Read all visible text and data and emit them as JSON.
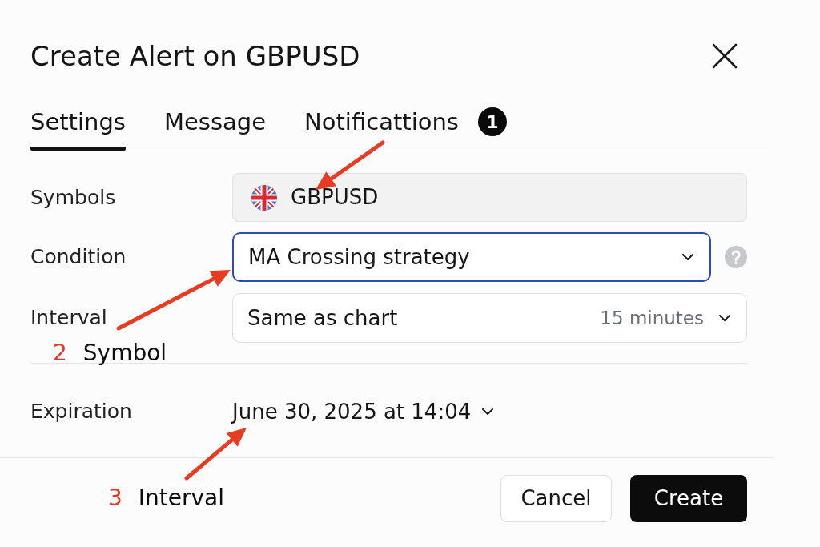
{
  "dialog": {
    "title": "Create Alert on GBPUSD"
  },
  "tabs": [
    {
      "label": "Settings",
      "selected": true
    },
    {
      "label": "Message",
      "selected": false
    },
    {
      "label": "Notificattions",
      "selected": false
    }
  ],
  "form": [
    {
      "kind": "symbol",
      "label": "Symbols",
      "value": "GBPUSD",
      "disabled": true,
      "help": false
    },
    {
      "kind": "select",
      "label": "Condition",
      "value": "MA Crossing strategy",
      "focused": true,
      "help": true
    },
    {
      "kind": "select",
      "label": "Interval",
      "value": "Same as chart",
      "detail": "15 minutes",
      "focused": false,
      "help": false
    }
  ],
  "expiration": {
    "label": "Expiration",
    "value": "June 30, 2025 at 14:04"
  },
  "buttons": [
    {
      "label": "Cancel",
      "kind": "secondary"
    },
    {
      "label": "Create",
      "kind": "primary"
    }
  ],
  "annotations": [
    {
      "kind": "badge",
      "number": "1"
    },
    {
      "kind": "callout",
      "number": "2",
      "label": "Symbol"
    },
    {
      "kind": "callout",
      "number": "3",
      "label": "Interval"
    }
  ]
}
